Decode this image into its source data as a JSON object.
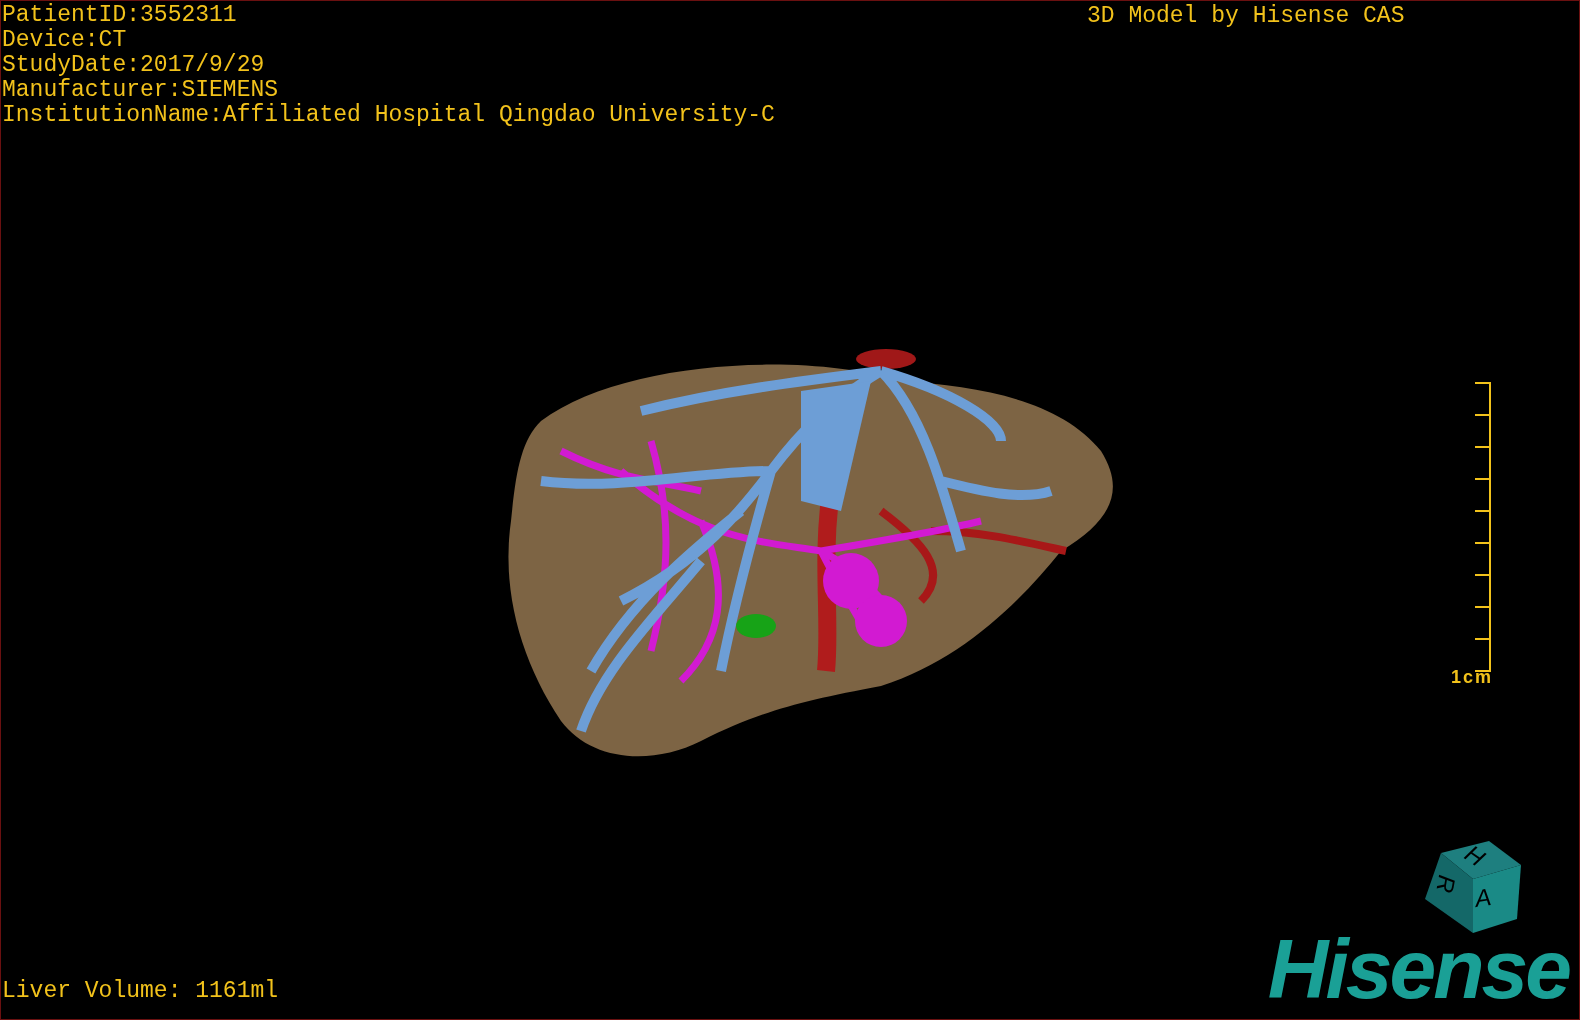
{
  "overlay_info": [
    "PatientID:3552311",
    "Device:CT",
    "StudyDate:2017/9/29",
    "Manufacturer:SIEMENS",
    "InstitutionName:Affiliated Hospital Qingdao University-C"
  ],
  "model_caption": "3D Model by Hisense CAS",
  "scale_bar": {
    "label": "1cm"
  },
  "orientation_cube": {
    "labels": [
      "H",
      "R",
      "A"
    ]
  },
  "logo": "Hisense",
  "liver_volume": "Liver Volume: 1161ml"
}
